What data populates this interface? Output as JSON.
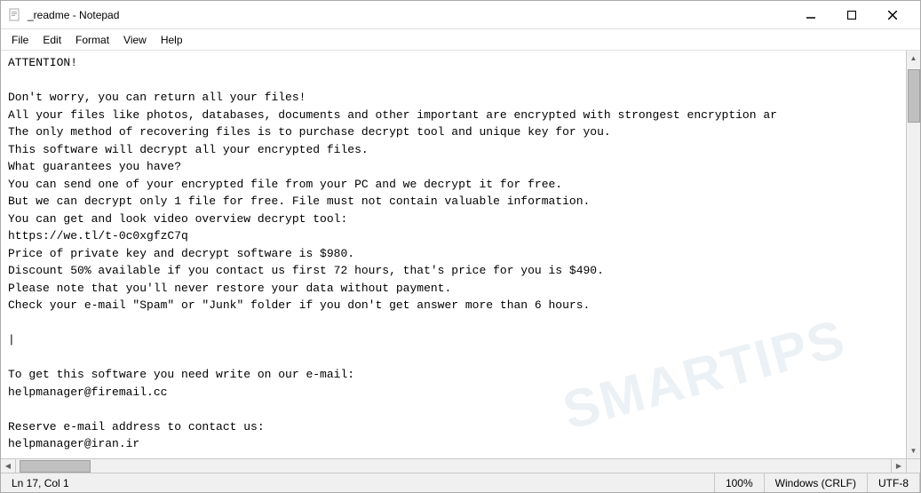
{
  "window": {
    "title": "_readme - Notepad",
    "icon": "📄"
  },
  "title_buttons": {
    "minimize": "─",
    "maximize": "□",
    "close": "✕"
  },
  "menu": {
    "items": [
      "File",
      "Edit",
      "Format",
      "View",
      "Help"
    ]
  },
  "content": "ATTENTION!\n\nDon't worry, you can return all your files!\nAll your files like photos, databases, documents and other important are encrypted with strongest encryption ar\nThe only method of recovering files is to purchase decrypt tool and unique key for you.\nThis software will decrypt all your encrypted files.\nWhat guarantees you have?\nYou can send one of your encrypted file from your PC and we decrypt it for free.\nBut we can decrypt only 1 file for free. File must not contain valuable information.\nYou can get and look video overview decrypt tool:\nhttps://we.tl/t-0c0xgfzC7q\nPrice of private key and decrypt software is $980.\nDiscount 50% available if you contact us first 72 hours, that's price for you is $490.\nPlease note that you'll never restore your data without payment.\nCheck your e-mail \"Spam\" or \"Junk\" folder if you don't get answer more than 6 hours.\n\n|\n\nTo get this software you need write on our e-mail:\nhelpmanager@firemail.cc\n\nReserve e-mail address to contact us:\nhelpmanager@iran.ir",
  "status": {
    "position": "Ln 17, Col 1",
    "zoom": "100%",
    "line_ending": "Windows (CRLF)",
    "encoding": "UTF-8"
  },
  "watermark": "SMARTIPS"
}
